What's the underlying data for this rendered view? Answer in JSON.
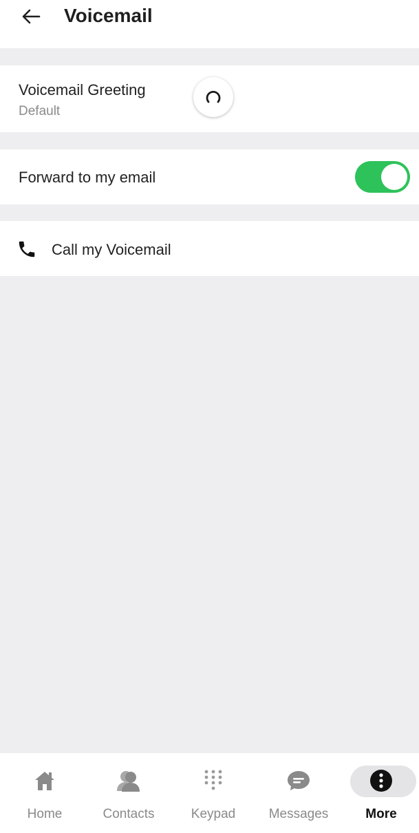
{
  "header": {
    "title": "Voicemail",
    "back_icon": "arrow-left-icon"
  },
  "greeting": {
    "title": "Voicemail Greeting",
    "subtitle": "Default",
    "status_icon": "loading-spinner-icon"
  },
  "forward": {
    "label": "Forward to my email",
    "enabled": true,
    "toggle_color": "#2ec25a"
  },
  "call": {
    "label": "Call my Voicemail",
    "icon": "phone-icon"
  },
  "nav": {
    "items": [
      {
        "label": "Home",
        "icon": "home-icon",
        "active": false
      },
      {
        "label": "Contacts",
        "icon": "contacts-icon",
        "active": false
      },
      {
        "label": "Keypad",
        "icon": "keypad-icon",
        "active": false
      },
      {
        "label": "Messages",
        "icon": "messages-icon",
        "active": false
      },
      {
        "label": "More",
        "icon": "more-icon",
        "active": true
      }
    ]
  },
  "colors": {
    "background": "#eeeef0",
    "inactive": "#8a8a8a",
    "accent": "#2ec25a"
  }
}
